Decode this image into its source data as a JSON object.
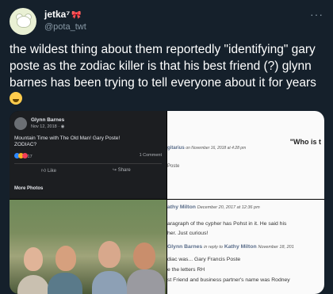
{
  "tweet": {
    "display_name": "jetka⁷",
    "handle": "@pota_twt",
    "text": "the wildest thing about them reportedly \"identifying\" gary poste as the zodiac killer is that his best friend (?) glynn barnes has been trying to tell everyone about it for years"
  },
  "fb_post": {
    "author": "Glynn Barnes",
    "date": "Nov 12, 2018 · ",
    "text_line1": "Mountain Time with The Old Man! Gary Poste!",
    "text_line2": "ZODIAC?",
    "reactions": "17",
    "comments": "1 Comment",
    "like": "Like",
    "share": "Share",
    "more_photos": "More Photos"
  },
  "doc_top": {
    "title": "\"Who is t",
    "user": "gitarius",
    "timestamp": "on November 16, 2018 at 4:28 pm",
    "line": "Poste"
  },
  "doc_bottom": {
    "user1": "athy Milton",
    "ts1": "December 20, 2017 at 12:36 pm",
    "line1": "aragraph of the cypher has Pohst in it. He said his",
    "line2": "her. Just curious!",
    "user2": "Glynn Barnes",
    "reply_to": "in reply to",
    "user3": "Kathy Milton",
    "ts2": "November 18, 201",
    "line3": "diac was... Gary Francis Poste",
    "line4": "e the letters RH",
    "line5": "st Friend and business partner's name was Rodney"
  },
  "colors": {
    "background": "#15202b",
    "text": "#ffffff",
    "muted": "#8899a6"
  }
}
